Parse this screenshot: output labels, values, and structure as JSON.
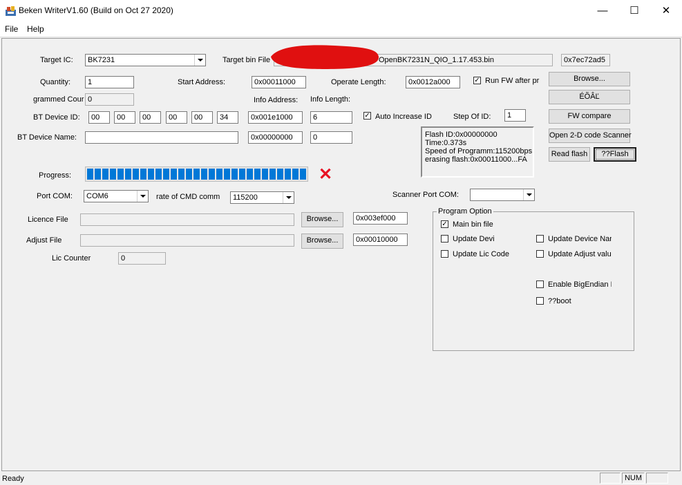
{
  "window": {
    "title": "Beken WriterV1.60 (Build on Oct 27 2020)",
    "minimize_glyph": "—",
    "maximize_glyph": "☐",
    "close_glyph": "✕"
  },
  "menu": {
    "file": "File",
    "help": "Help"
  },
  "form": {
    "target_ic_label": "Target IC:",
    "target_ic_value": "BK7231",
    "target_bin_label": "Target bin File",
    "target_bin_value": "OpenBK7231N_QIO_1.17.453.bin",
    "checksum": "0x7ec72ad5",
    "quantity_label": "Quantity:",
    "quantity_value": "1",
    "start_address_label": "Start Address:",
    "start_address_value": "0x00011000",
    "operate_length_label": "Operate Length:",
    "operate_length_value": "0x0012a000",
    "run_fw_label": "Run FW after pr",
    "programmed_count_label": "grammed Cour",
    "programmed_count_value": "0",
    "info_address_label": "Info Address:",
    "info_length_label": "Info Length:",
    "bt_device_id_label": "BT Device ID:",
    "bt_device_id": [
      "00",
      "00",
      "00",
      "00",
      "00",
      "34"
    ],
    "info_address_value": "0x001e1000",
    "info_length_value": "6",
    "auto_increase_label": "Auto Increase ID",
    "step_of_id_label": "Step Of ID:",
    "step_of_id_value": "1",
    "bt_device_name_label": "BT Device Name:",
    "bt_device_name_value": "",
    "name_address_value": "0x00000000",
    "name_length_value": "0",
    "progress_label": "Progress:",
    "progress_fraction": 1.0,
    "port_com_label": "Port COM:",
    "port_com_value": "COM6",
    "cmd_rate_label": "rate of CMD comm",
    "cmd_rate_value": "115200",
    "scanner_port_label": "Scanner Port COM:",
    "scanner_port_value": "",
    "licence_file_label": "Licence File",
    "licence_file_value": "",
    "licence_address": "0x003ef000",
    "adjust_file_label": "Adjust File",
    "adjust_file_value": "",
    "adjust_address": "0x00010000",
    "lic_counter_label": "Lic Counter",
    "lic_counter_value": "0",
    "browse_label": "Browse..."
  },
  "buttons": {
    "browse_bin": "Browse...",
    "erase": "ÉÕÂĽ",
    "fw_compare": "FW compare",
    "open_scanner": "Open 2-D code Scanner",
    "read_flash": "Read flash",
    "flash": "??Flash"
  },
  "log_lines": [
    "Flash ID:0x00000000",
    "Time:0.373s",
    "Speed of Programm:115200bps",
    "erasing flash:0x00011000...FA"
  ],
  "program_option": {
    "title": "Program Option",
    "main_bin": "Main bin file",
    "update_devi": "Update Devi",
    "update_device_name": "Update Device Nan",
    "update_lic_code": "Update Lic Code",
    "update_adjust": "Update Adjust valu",
    "enable_bigendian": "Enable BigEndian II",
    "boot": "??boot"
  },
  "status": {
    "text": "Ready",
    "num": "NUM"
  },
  "colors": {
    "progress": "#0078d7",
    "error_mark": "#e81123",
    "redaction": "#e01010"
  },
  "icons": {
    "fail_mark": "✕",
    "check": "✓"
  }
}
